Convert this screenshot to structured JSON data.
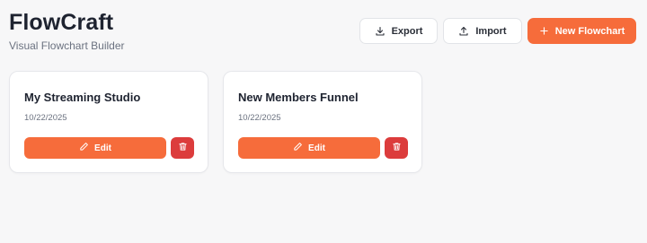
{
  "app": {
    "title": "FlowCraft",
    "subtitle": "Visual Flowchart Builder"
  },
  "toolbar": {
    "export_label": "Export",
    "export_icon": "download-icon",
    "import_label": "Import",
    "import_icon": "upload-icon",
    "new_label": "New Flowchart",
    "new_icon": "plus-icon"
  },
  "flowcharts": [
    {
      "title": "My Streaming Studio",
      "date": "10/22/2025",
      "edit_label": "Edit",
      "edit_icon": "pencil-icon",
      "delete_icon": "trash-icon"
    },
    {
      "title": "New Members Funnel",
      "date": "10/22/2025",
      "edit_label": "Edit",
      "edit_icon": "pencil-icon",
      "delete_icon": "trash-icon"
    }
  ],
  "colors": {
    "accent": "#f66c3b",
    "danger": "#dc3c3c",
    "background": "#f7f7f8"
  }
}
